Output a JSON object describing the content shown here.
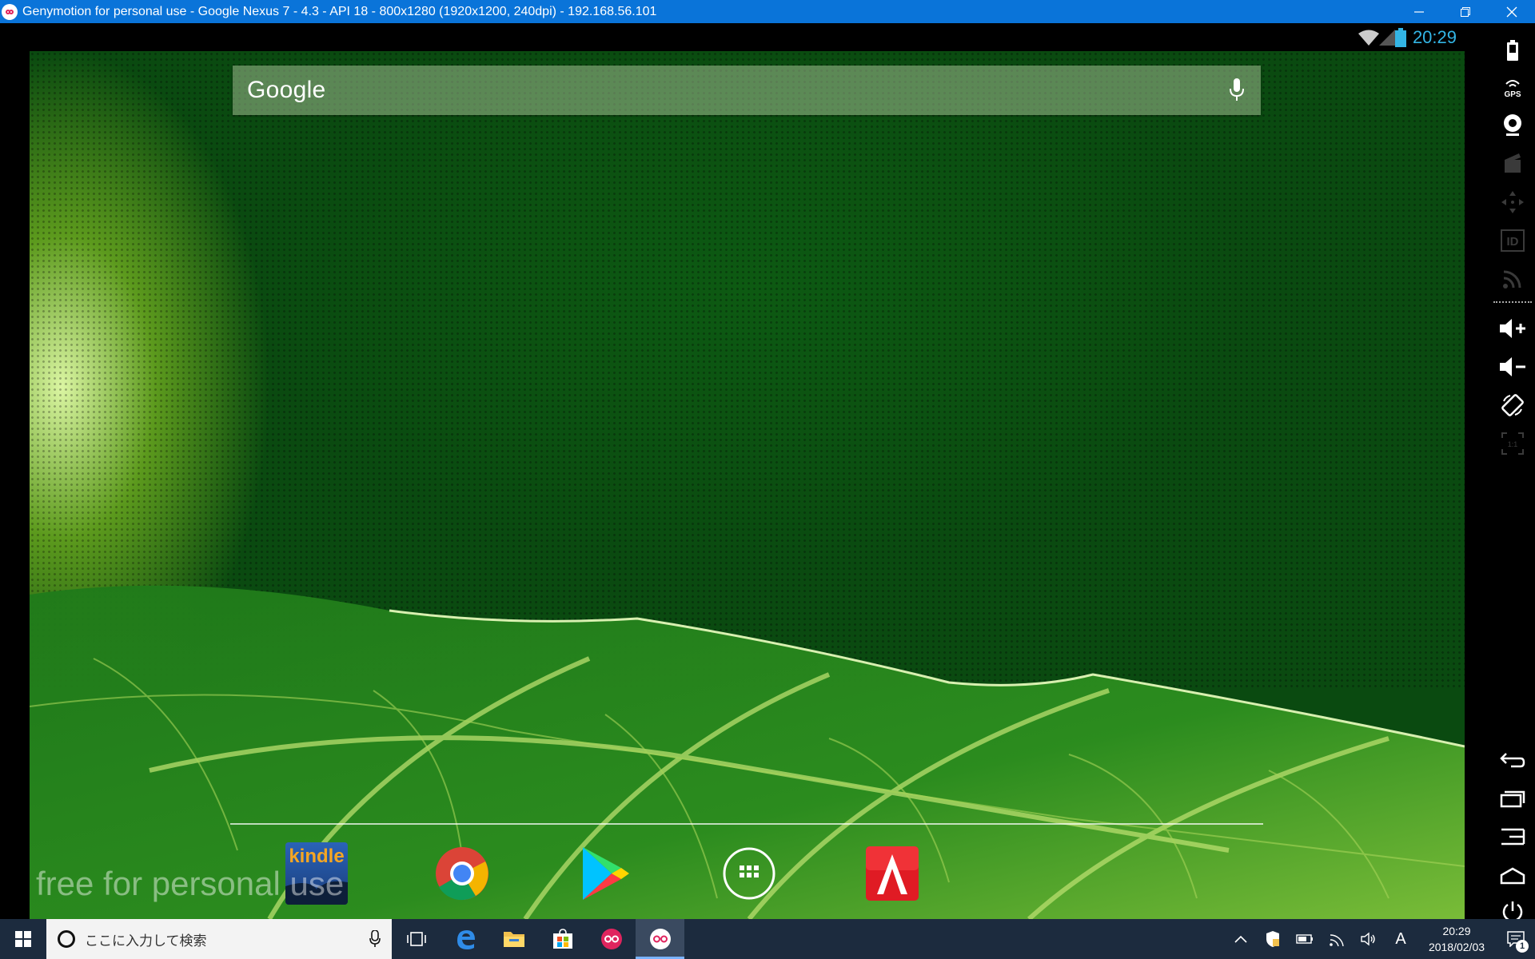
{
  "window": {
    "title": "Genymotion for personal use - Google Nexus 7 - 4.3 - API 18 - 800x1280 (1920x1200, 240dpi) - 192.168.56.101",
    "buttons": {
      "minimize": "minimize-icon",
      "restore": "restore-icon",
      "close": "close-icon"
    }
  },
  "android": {
    "status": {
      "clock": "20:29",
      "icons": [
        "wifi-icon",
        "signal-icon",
        "battery-icon"
      ]
    },
    "search": {
      "logo": "Google",
      "mic": "mic-icon"
    },
    "watermark": "free for personal use",
    "dock": [
      {
        "name": "Kindle",
        "label": "kindle",
        "icon": "kindle-icon"
      },
      {
        "name": "Chrome",
        "icon": "chrome-icon"
      },
      {
        "name": "Play Store",
        "icon": "play-store-icon"
      },
      {
        "name": "All apps",
        "icon": "app-drawer-icon"
      },
      {
        "name": "Adobe Reader",
        "icon": "adobe-reader-icon"
      }
    ]
  },
  "sidepanel": {
    "items": [
      "battery-icon",
      "gps-icon",
      "webcam-icon",
      "capture-icon",
      "dpad-icon",
      "device-id-icon",
      "cast-icon",
      "volume-up-icon",
      "volume-down-icon",
      "rotate-icon",
      "pixel-perfect-icon",
      "back-icon",
      "recent-apps-icon",
      "menu-icon",
      "home-icon",
      "power-icon"
    ],
    "pixel_label": "1:1",
    "id_label": "ID"
  },
  "taskbar": {
    "search_placeholder": "ここに入力して検索",
    "apps": [
      "task-view-icon",
      "edge-icon",
      "file-explorer-icon",
      "store-icon",
      "genymotion-icon",
      "genymotion-device-icon"
    ],
    "tray": {
      "icons": [
        "chevron-up-icon",
        "defender-icon",
        "battery-icon",
        "network-icon",
        "volume-icon"
      ],
      "ime": "A",
      "time": "20:29",
      "date": "2018/02/03",
      "notification_count": "1"
    }
  },
  "colors": {
    "titlebar": "#0a74d9",
    "taskbar": "#1c2b3e",
    "clock": "#33b5e5"
  }
}
